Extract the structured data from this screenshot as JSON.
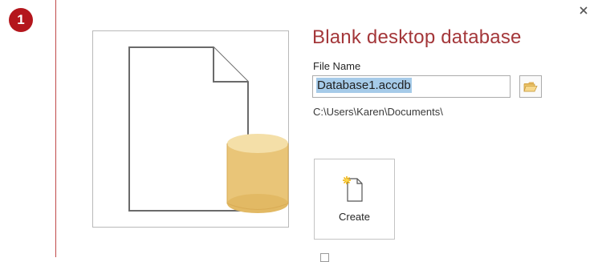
{
  "step": {
    "number": "1"
  },
  "dialog": {
    "title": "Blank desktop database",
    "file_name_label": "File Name",
    "file_name_value": "Database1.accdb",
    "save_path": "C:\\Users\\Karen\\Documents\\",
    "create_label": "Create"
  },
  "icons": {
    "close": "close-icon",
    "browse": "folder-icon",
    "create": "new-document-icon",
    "preview": "blank-database-icon"
  },
  "colors": {
    "accent": "#a4373a",
    "badge": "#b4161c",
    "selection": "#a6cbe9",
    "database": "#e9c578"
  }
}
